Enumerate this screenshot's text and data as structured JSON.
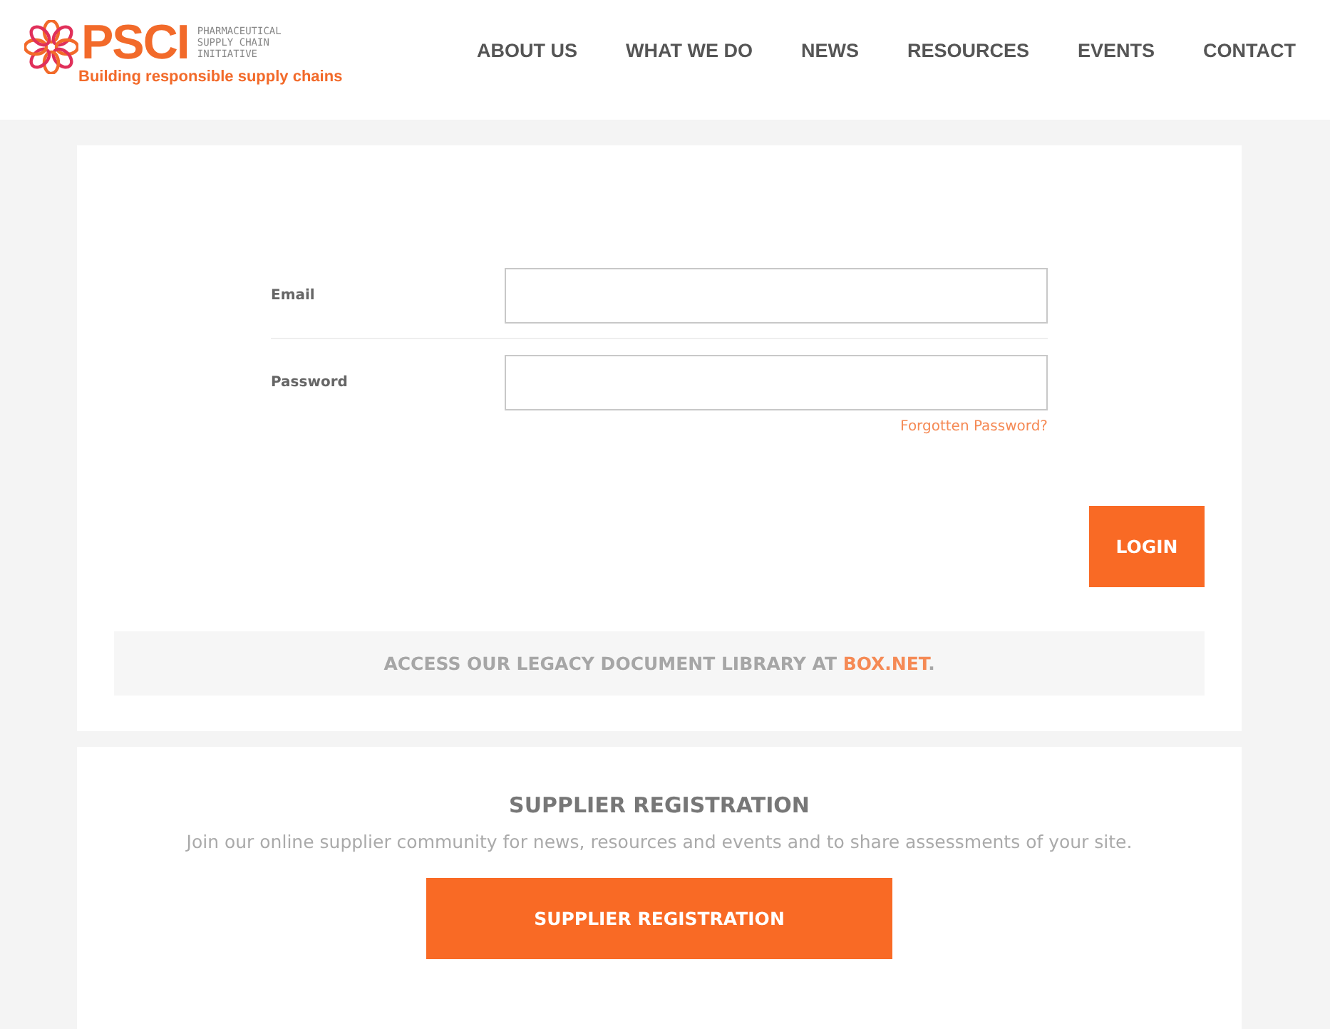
{
  "logo": {
    "mark": "PSCI",
    "name_lines": [
      "PHARMACEUTICAL",
      "SUPPLY CHAIN",
      "INITIATIVE"
    ],
    "tagline": "Building responsible supply chains"
  },
  "nav": [
    "ABOUT US",
    "WHAT WE DO",
    "NEWS",
    "RESOURCES",
    "EVENTS",
    "CONTACT"
  ],
  "login": {
    "fields": [
      {
        "label": "Email"
      },
      {
        "label": "Password"
      }
    ],
    "forgot_link": "Forgotten Password?",
    "button": "LOGIN"
  },
  "legacy": {
    "text": "ACCESS OUR LEGACY DOCUMENT LIBRARY AT",
    "link": "BOX.NET",
    "after": "."
  },
  "registration": {
    "title": "SUPPLIER REGISTRATION",
    "description": "Join our online supplier community for news, resources and events and to share assessments of your site.",
    "button": "SUPPLIER REGISTRATION"
  }
}
